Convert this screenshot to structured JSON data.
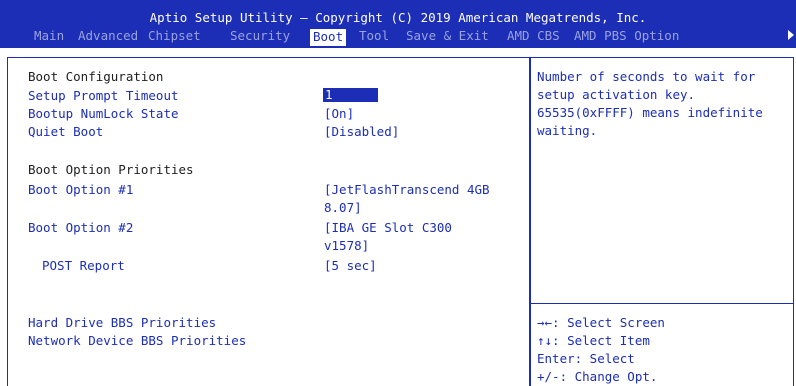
{
  "header": {
    "title": "Aptio Setup Utility – Copyright (C) 2019 American Megatrends, Inc.",
    "tabs": [
      {
        "label": "Main",
        "active": false
      },
      {
        "label": "Advanced",
        "active": false
      },
      {
        "label": "Chipset",
        "active": false
      },
      {
        "label": "Security",
        "active": false
      },
      {
        "label": "Boot",
        "active": true
      },
      {
        "label": "Tool",
        "active": false
      },
      {
        "label": "Save & Exit",
        "active": false
      },
      {
        "label": "AMD CBS",
        "active": false
      },
      {
        "label": "AMD PBS Option",
        "active": false
      }
    ]
  },
  "boot": {
    "config_heading": "Boot Configuration",
    "setup_prompt_timeout_label": "Setup Prompt Timeout",
    "setup_prompt_timeout_value": "1",
    "numlock_label": "Bootup NumLock State",
    "numlock_value": "[On]",
    "quiet_boot_label": "Quiet Boot",
    "quiet_boot_value": "[Disabled]",
    "priorities_heading": "Boot Option Priorities",
    "option1_label": "Boot Option #1",
    "option1_value_line1": "[JetFlashTranscend 4GB",
    "option1_value_line2": "8.07]",
    "option2_label": "Boot Option #2",
    "option2_value_line1": "[IBA GE Slot C300",
    "option2_value_line2": "v1578]",
    "post_report_label": "POST Report",
    "post_report_value": "[5 sec]",
    "hdd_bbs_label": "Hard Drive BBS Priorities",
    "net_bbs_label": "Network Device BBS Priorities"
  },
  "help": {
    "line1": "Number of seconds to wait for",
    "line2": "setup activation key.",
    "line3": "65535(0xFFFF) means indefinite",
    "line4": "waiting."
  },
  "keys": {
    "select_screen": "→←: Select Screen",
    "select_item": "↑↓: Select Item",
    "enter": "Enter: Select",
    "change": "+/-: Change Opt."
  },
  "colors": {
    "bios_blue": "#1c2eb6",
    "background": "#ffffff",
    "heading_text": "#1f1f1f"
  }
}
